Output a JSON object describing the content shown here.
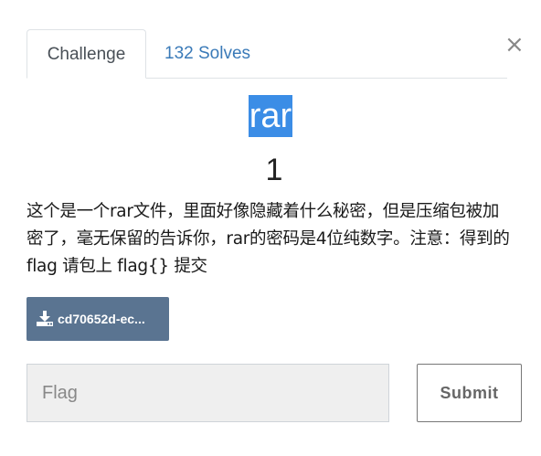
{
  "tabs": [
    {
      "label": "Challenge",
      "active": true
    },
    {
      "label": "132 Solves",
      "active": false
    }
  ],
  "close_label": "×",
  "challenge": {
    "name": "rar",
    "value": "1",
    "description": "这个是一个rar文件，里面好像隐藏着什么秘密，但是压缩包被加密了，毫无保留的告诉你，rar的密码是4位纯数字。注意：得到的 flag 请包上 flag{} 提交",
    "file_label": "cd70652d-ec..."
  },
  "form": {
    "flag_placeholder": "Flag",
    "submit_label": "Submit"
  },
  "colors": {
    "title_highlight": "#3b8de6",
    "file_button": "#5a7491",
    "link": "#3a7ab8"
  },
  "icons": {
    "close": "close-icon",
    "file": "download-icon"
  }
}
